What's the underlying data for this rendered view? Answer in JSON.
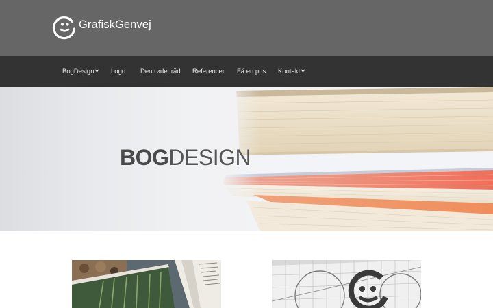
{
  "brand": {
    "name": "GrafiskGenvej",
    "logo_icon": "smiley-g-logo-icon"
  },
  "nav": {
    "items": [
      {
        "label": "BogDesign",
        "has_dropdown": true
      },
      {
        "label": "Logo",
        "has_dropdown": false
      },
      {
        "label": "Den røde tråd",
        "has_dropdown": false
      },
      {
        "label": "Referencer",
        "has_dropdown": false
      },
      {
        "label": "Få en pris",
        "has_dropdown": false
      },
      {
        "label": "Kontakt",
        "has_dropdown": true
      }
    ]
  },
  "hero": {
    "title_bold": "BOG",
    "title_light": "DESIGN"
  },
  "colors": {
    "topbar": "#666666",
    "navbar": "#333333",
    "nav_text": "#e6e6e6",
    "hero_text": "#4a4a4a"
  }
}
